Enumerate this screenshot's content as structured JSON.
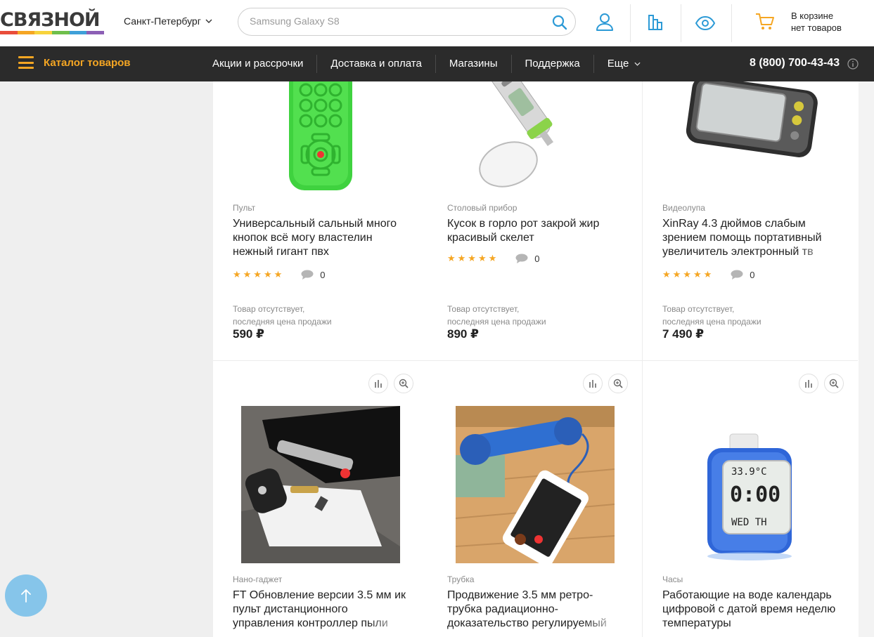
{
  "header": {
    "logo_text": "СВЯЗНОЙ",
    "city": "Санкт-Петербург",
    "search_placeholder": "Samsung Galaxy S8",
    "cart_line1": "В корзине",
    "cart_line2": "нет товаров"
  },
  "nav": {
    "catalog_label": "Каталог товаров",
    "items": [
      {
        "label": "Акции и рассрочки"
      },
      {
        "label": "Доставка и оплата"
      },
      {
        "label": "Магазины"
      },
      {
        "label": "Поддержка"
      },
      {
        "label": "Еще"
      }
    ],
    "phone": "8 (800) 700-43-43"
  },
  "colors": {
    "accent": "#f5a623",
    "nav_bg": "#2b2b2b",
    "icon_blue": "#2c9ad6",
    "logo_stripes": [
      "#e94d3a",
      "#f5a623",
      "#f7d33c",
      "#6fbf4b",
      "#3fa0d8",
      "#8c5fb5"
    ]
  },
  "products": [
    {
      "category": "Пульт",
      "title": "Универсальный сальный много кнопок всё могу властелин нежный гигант пвх",
      "stars": "★★★★★",
      "comments": "0",
      "status_line1": "Товар отсутствует,",
      "status_line2": "последняя цена продажи",
      "price": "590 ₽",
      "image": "green-remote"
    },
    {
      "category": "Столовый прибор",
      "title": "Кусок в горло рот закрой жир красивый скелет",
      "stars": "★★★★★",
      "comments": "0",
      "status_line1": "Товар отсутствует,",
      "status_line2": "последняя цена продажи",
      "price": "890 ₽",
      "image": "scale-spoon"
    },
    {
      "category": "Видеолупа",
      "title": "XinRay 4.3 дюймов слабым зрением помощь портативный увеличитель электронный тв",
      "stars": "★★★★★",
      "comments": "0",
      "status_line1": "Товар отсутствует,",
      "status_line2": "последняя цена продажи",
      "price": "7 490 ₽",
      "image": "video-magnifier"
    },
    {
      "category": "Нано-гаджет",
      "title": "FT Обновление версии 3.5 мм ик пульт дистанционного управления контроллер пыли",
      "image": "phone-ir-gadget"
    },
    {
      "category": "Трубка",
      "title": "Продвижение 3.5 мм ретро-трубка радиационно-доказательство регулируемый",
      "image": "retro-handset"
    },
    {
      "category": "Часы",
      "title": "Работающие на воде календарь цифровой с датой время неделю температуры",
      "image": "water-clock",
      "clock_temp": "33.9°C",
      "clock_time": "0:00",
      "clock_day": "WED TH"
    }
  ]
}
